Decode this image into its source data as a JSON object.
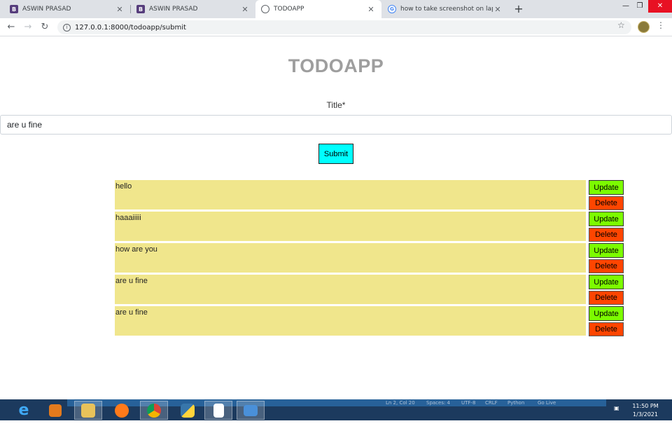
{
  "browser": {
    "tabs": [
      {
        "label": "ASWIN PRASAD",
        "favicon": "bootstrap-icon",
        "active": false
      },
      {
        "label": "ASWIN PRASAD",
        "favicon": "bootstrap-icon",
        "active": false
      },
      {
        "label": "TODOAPP",
        "favicon": "globe-icon",
        "active": true
      },
      {
        "label": "how to take screenshot on lapto",
        "favicon": "google-icon",
        "active": false
      }
    ],
    "new_tab_label": "+",
    "url": "127.0.0.1:8000/todoapp/submit"
  },
  "page": {
    "app_title": "TODOAPP",
    "form": {
      "title_label": "Title*",
      "title_value": "are u fine",
      "submit_label": "Submit"
    },
    "todos": [
      {
        "text": "hello",
        "update_label": "Update",
        "delete_label": "Delete"
      },
      {
        "text": "haaaiiiii",
        "update_label": "Update",
        "delete_label": "Delete"
      },
      {
        "text": "how are you",
        "update_label": "Update",
        "delete_label": "Delete"
      },
      {
        "text": "are u fine",
        "update_label": "Update",
        "delete_label": "Delete"
      },
      {
        "text": "are u fine",
        "update_label": "Update",
        "delete_label": "Delete"
      }
    ]
  },
  "colors": {
    "title": "#9e9e9e",
    "submit_bg": "#00ffff",
    "todo_bg": "#f0e68c",
    "update_bg": "#7cfc00",
    "delete_bg": "#ff4500"
  },
  "taskbar": {
    "status_bar": {
      "cursor": "Ln 2, Col 20",
      "spaces": "Spaces: 4",
      "encoding": "UTF-8",
      "eol": "CRLF",
      "language": "Python",
      "go_live": "Go Live"
    },
    "time": "11:50 PM",
    "date": "1/3/2021"
  }
}
